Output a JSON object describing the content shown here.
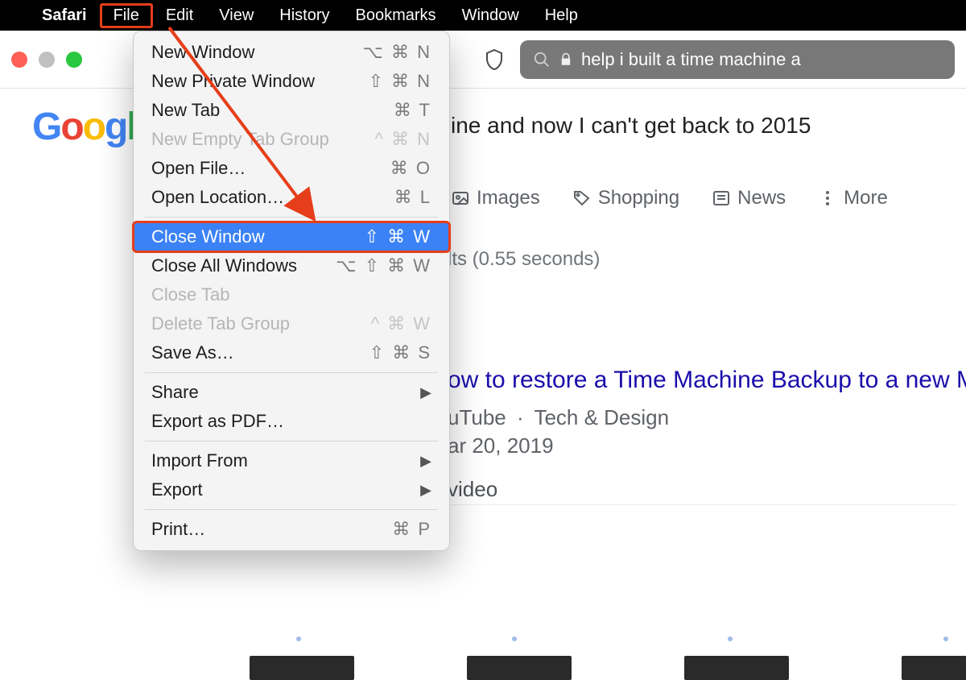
{
  "menubar": {
    "app": "Safari",
    "items": [
      "File",
      "Edit",
      "View",
      "History",
      "Bookmarks",
      "Window",
      "Help"
    ]
  },
  "urlbar": {
    "text": "help i built a time machine a"
  },
  "search": {
    "query_tail": "ine and now I can't get back to 2015",
    "tabs": {
      "images": "Images",
      "shopping": "Shopping",
      "news": "News",
      "more": "More"
    },
    "stats": "lts (0.55 seconds)",
    "result": {
      "title_tail": "ow to restore a Time Machine Backup to a new Mac",
      "site": "uTube",
      "channel": "Tech & Design",
      "date": "ar 20, 2019",
      "video_label": " video"
    }
  },
  "file_menu": {
    "new_window": {
      "label": "New Window",
      "shortcut": "⌥ ⌘ N"
    },
    "new_private": {
      "label": "New Private Window",
      "shortcut": "⇧ ⌘ N"
    },
    "new_tab": {
      "label": "New Tab",
      "shortcut": "⌘ T"
    },
    "new_empty_group": {
      "label": "New Empty Tab Group",
      "shortcut": "^ ⌘ N"
    },
    "open_file": {
      "label": "Open File…",
      "shortcut": "⌘ O"
    },
    "open_location": {
      "label": "Open Location…",
      "shortcut": "⌘ L"
    },
    "close_window": {
      "label": "Close Window",
      "shortcut": "⇧ ⌘ W"
    },
    "close_all_windows": {
      "label": "Close All Windows",
      "shortcut": "⌥ ⇧ ⌘ W"
    },
    "close_tab": {
      "label": "Close Tab",
      "shortcut": ""
    },
    "delete_tab_group": {
      "label": "Delete Tab Group",
      "shortcut": "^ ⌘ W"
    },
    "save_as": {
      "label": "Save As…",
      "shortcut": "⇧ ⌘ S"
    },
    "share": {
      "label": "Share",
      "shortcut": ""
    },
    "export_pdf": {
      "label": "Export as PDF…",
      "shortcut": ""
    },
    "import_from": {
      "label": "Import From",
      "shortcut": ""
    },
    "export": {
      "label": "Export",
      "shortcut": ""
    },
    "print": {
      "label": "Print…",
      "shortcut": "⌘ P"
    }
  }
}
